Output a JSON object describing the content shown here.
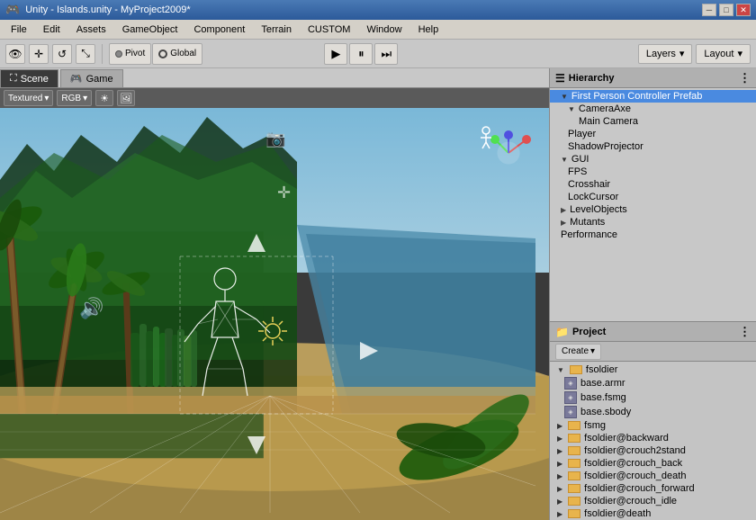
{
  "titlebar": {
    "title": "Unity - Islands.unity - MyProject2009*",
    "minimize": "─",
    "maximize": "□",
    "close": "✕"
  },
  "menubar": {
    "items": [
      "File",
      "Edit",
      "Assets",
      "GameObject",
      "Component",
      "Terrain",
      "CUSTOM",
      "Window",
      "Help"
    ]
  },
  "toolbar": {
    "eye_icon": "👁",
    "move_icon": "✛",
    "rotate_icon": "↺",
    "scale_icon": "⤡",
    "pivot_label": "Pivot",
    "global_label": "Global",
    "play_icon": "▶",
    "pause_icon": "⏸",
    "step_icon": "⏭",
    "layers_label": "Layers",
    "layout_label": "Layout",
    "dropdown_arrow": "▾"
  },
  "view_tabs": {
    "scene_label": "Scene",
    "game_label": "Game"
  },
  "scene_toolbar": {
    "textured_label": "Textured",
    "rgb_label": "RGB",
    "dropdown_arrow": "▾"
  },
  "hierarchy": {
    "title": "Hierarchy",
    "items": [
      {
        "label": "First Person Controller Prefab",
        "indent": 0,
        "expanded": true,
        "selected": true
      },
      {
        "label": "CameraAxe",
        "indent": 1,
        "expanded": true
      },
      {
        "label": "Main Camera",
        "indent": 2
      },
      {
        "label": "Player",
        "indent": 1
      },
      {
        "label": "ShadowProjector",
        "indent": 1
      },
      {
        "label": "GUI",
        "indent": 0,
        "expanded": true
      },
      {
        "label": "FPS",
        "indent": 1
      },
      {
        "label": "Crosshair",
        "indent": 1
      },
      {
        "label": "LockCursor",
        "indent": 1
      },
      {
        "label": "LevelObjects",
        "indent": 0,
        "collapsed": true
      },
      {
        "label": "Mutants",
        "indent": 0,
        "collapsed": true
      },
      {
        "label": "Performance",
        "indent": 0
      }
    ]
  },
  "project": {
    "title": "Project",
    "create_label": "Create",
    "items": [
      {
        "label": "fsoldier",
        "indent": 0,
        "type": "folder",
        "expanded": true
      },
      {
        "label": "base.armr",
        "indent": 1,
        "type": "file"
      },
      {
        "label": "base.fsmg",
        "indent": 1,
        "type": "file"
      },
      {
        "label": "base.sbody",
        "indent": 1,
        "type": "file"
      },
      {
        "label": "fsmg",
        "indent": 0,
        "type": "folder"
      },
      {
        "label": "fsoldier@backward",
        "indent": 0,
        "type": "folder"
      },
      {
        "label": "fsoldier@crouch2stand",
        "indent": 0,
        "type": "folder"
      },
      {
        "label": "fsoldier@crouch_back",
        "indent": 0,
        "type": "folder"
      },
      {
        "label": "fsoldier@crouch_death",
        "indent": 0,
        "type": "folder"
      },
      {
        "label": "fsoldier@crouch_forward",
        "indent": 0,
        "type": "folder"
      },
      {
        "label": "fsoldier@crouch_idle",
        "indent": 0,
        "type": "folder"
      },
      {
        "label": "fsoldier@death",
        "indent": 0,
        "type": "folder"
      }
    ]
  },
  "colors": {
    "accent_blue": "#3a7bd5",
    "panel_bg": "#c0c0c0",
    "panel_header": "#b0b0b0",
    "selected_bg": "#4a8ae0"
  }
}
